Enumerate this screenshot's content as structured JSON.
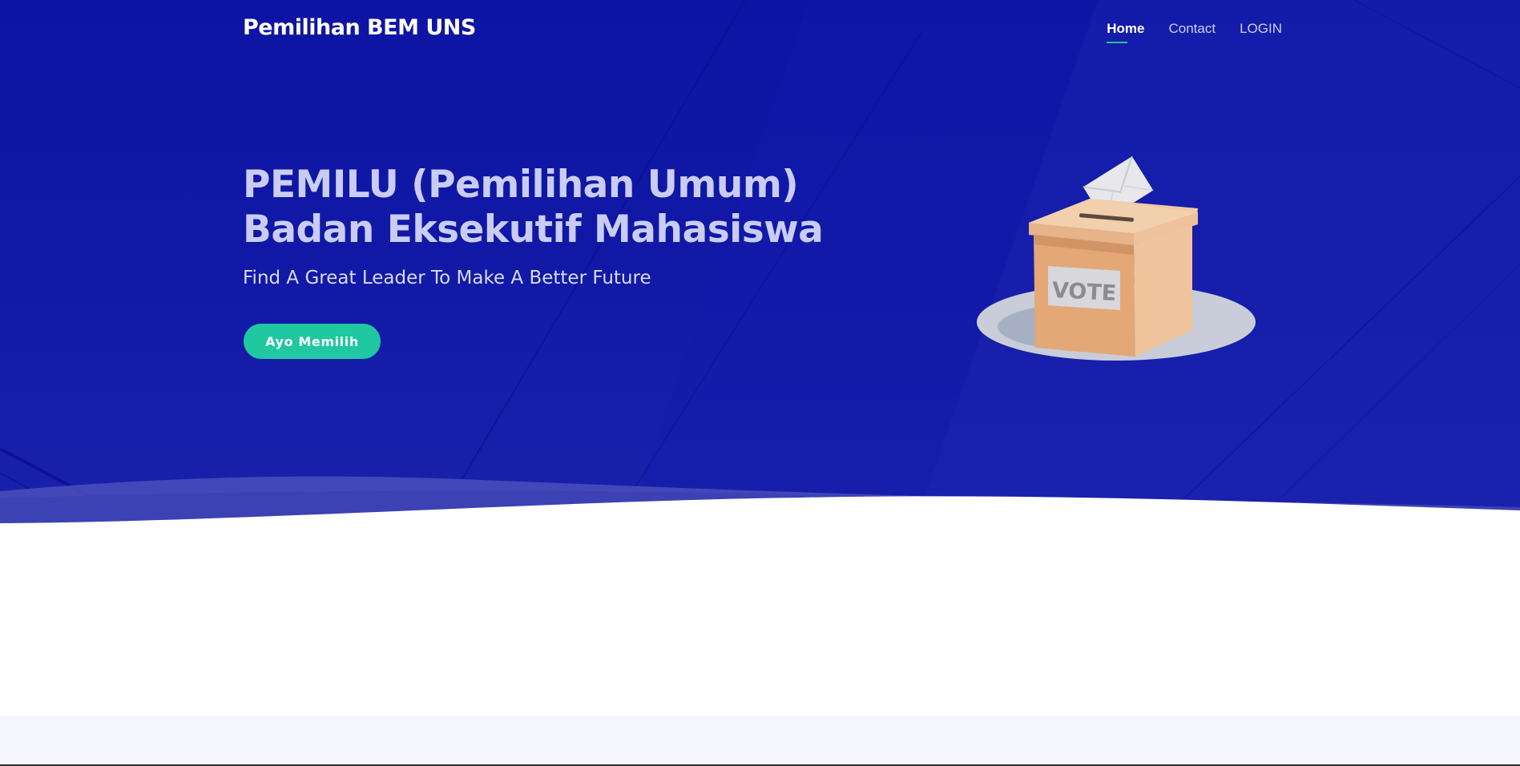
{
  "navbar": {
    "brand": "Pemilihan BEM UNS",
    "links": [
      {
        "label": "Home",
        "active": true
      },
      {
        "label": "Contact",
        "active": false
      },
      {
        "label": "LOGIN",
        "active": false
      }
    ]
  },
  "hero": {
    "title_line1": "PEMILU (Pemilihan Umum)",
    "title_line2": "Badan Eksekutif Mahasiswa",
    "subtitle": "Find A Great Leader To Make A Better Future",
    "cta_label": "Ayo Memilih",
    "illustration": {
      "icon": "ballot-box-icon",
      "box_label": "VOTE"
    }
  },
  "colors": {
    "hero_background": "#0f16a5",
    "accent": "#1fc8a0",
    "title_text": "#c9cdf5",
    "page_background": "#ffffff",
    "section_band": "#f5f6fe"
  }
}
